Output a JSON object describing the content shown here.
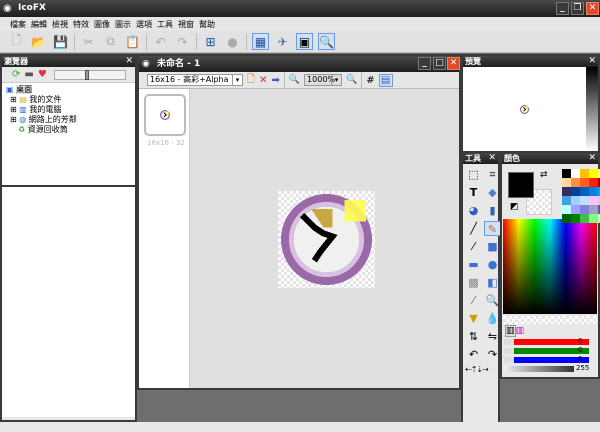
{
  "app": {
    "title": "IcoFX"
  },
  "menu": [
    "檔案",
    "編輯",
    "檢視",
    "特效",
    "圖像",
    "圖示",
    "選項",
    "工具",
    "視窗",
    "幫助"
  ],
  "browser": {
    "title": "瀏覽器",
    "tree": [
      {
        "label": "桌面"
      },
      {
        "label": "我的文件"
      },
      {
        "label": "我的電腦"
      },
      {
        "label": "網路上的芳鄰"
      },
      {
        "label": "資源回收筒"
      }
    ]
  },
  "document": {
    "title": "未命名 - 1",
    "format": "16x16 - 高彩+Alpha",
    "zoom": "1000%",
    "thumbnail_label": "16x16 - 32"
  },
  "preview": {
    "title": "預覽"
  },
  "tools": {
    "title": "工具"
  },
  "colors": {
    "title": "顏色",
    "red": "0",
    "green": "0",
    "blue": "0",
    "alpha": "255",
    "swatches": [
      "#000000",
      "#ffffff",
      "#ffc000",
      "#ffff00",
      "#ffff80",
      "#ffd8a0",
      "#ff9040",
      "#ff6020",
      "#ff2000",
      "#a00000",
      "#303060",
      "#0040a0",
      "#0060c0",
      "#0080e0",
      "#00a0ff",
      "#40a0e0",
      "#a0d0ff",
      "#c0e0ff",
      "#ffc0ff",
      "#e0c0ff",
      "#c0ffff",
      "#a0a0ff",
      "#8080e0",
      "#a0a0c0",
      "#606090",
      "#006000",
      "#008000",
      "#40c040",
      "#80ff80",
      "#c0ffc0"
    ]
  }
}
